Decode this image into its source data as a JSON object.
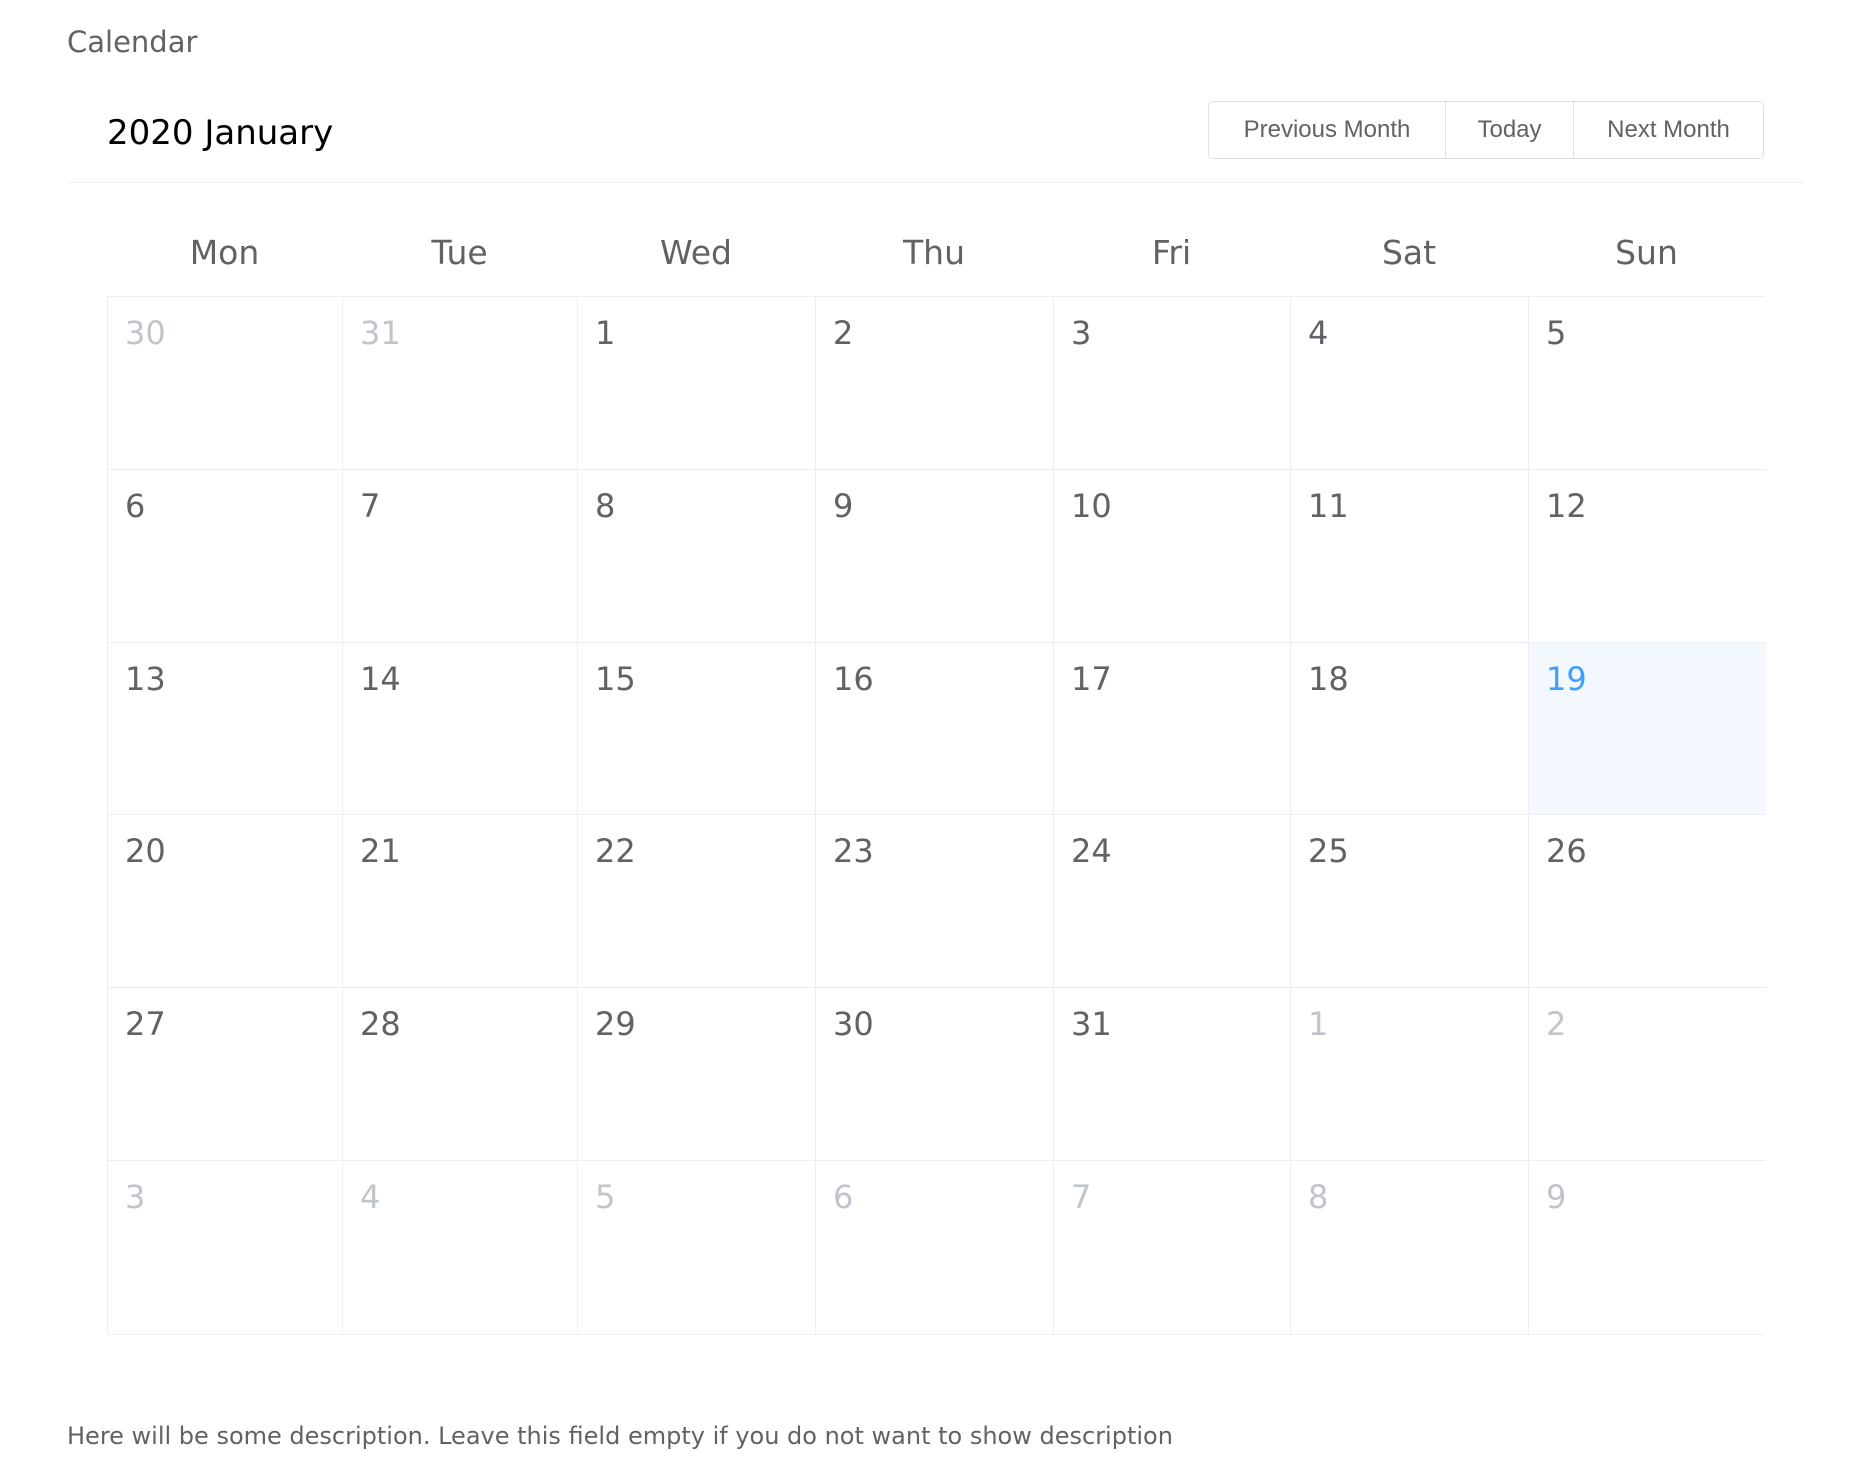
{
  "page_label": "Calendar",
  "header": {
    "title": "2020 January",
    "buttons": {
      "previous": "Previous Month",
      "today": "Today",
      "next": "Next Month"
    }
  },
  "weekdays": [
    "Mon",
    "Tue",
    "Wed",
    "Thu",
    "Fri",
    "Sat",
    "Sun"
  ],
  "colors": {
    "selected_background": "#f2f8fe",
    "selected_text": "#409eff",
    "other_month_text": "#c0c4cc",
    "border": "#ebeef5"
  },
  "weeks": [
    [
      {
        "day": "30",
        "state": "prev"
      },
      {
        "day": "31",
        "state": "prev"
      },
      {
        "day": "1",
        "state": "current"
      },
      {
        "day": "2",
        "state": "current"
      },
      {
        "day": "3",
        "state": "current"
      },
      {
        "day": "4",
        "state": "current"
      },
      {
        "day": "5",
        "state": "current"
      }
    ],
    [
      {
        "day": "6",
        "state": "current"
      },
      {
        "day": "7",
        "state": "current"
      },
      {
        "day": "8",
        "state": "current"
      },
      {
        "day": "9",
        "state": "current"
      },
      {
        "day": "10",
        "state": "current"
      },
      {
        "day": "11",
        "state": "current"
      },
      {
        "day": "12",
        "state": "current"
      }
    ],
    [
      {
        "day": "13",
        "state": "current"
      },
      {
        "day": "14",
        "state": "current"
      },
      {
        "day": "15",
        "state": "current"
      },
      {
        "day": "16",
        "state": "current"
      },
      {
        "day": "17",
        "state": "current"
      },
      {
        "day": "18",
        "state": "current"
      },
      {
        "day": "19",
        "state": "current",
        "selected": true
      }
    ],
    [
      {
        "day": "20",
        "state": "current"
      },
      {
        "day": "21",
        "state": "current"
      },
      {
        "day": "22",
        "state": "current"
      },
      {
        "day": "23",
        "state": "current"
      },
      {
        "day": "24",
        "state": "current"
      },
      {
        "day": "25",
        "state": "current"
      },
      {
        "day": "26",
        "state": "current"
      }
    ],
    [
      {
        "day": "27",
        "state": "current"
      },
      {
        "day": "28",
        "state": "current"
      },
      {
        "day": "29",
        "state": "current"
      },
      {
        "day": "30",
        "state": "current"
      },
      {
        "day": "31",
        "state": "current"
      },
      {
        "day": "1",
        "state": "next"
      },
      {
        "day": "2",
        "state": "next"
      }
    ],
    [
      {
        "day": "3",
        "state": "next"
      },
      {
        "day": "4",
        "state": "next"
      },
      {
        "day": "5",
        "state": "next"
      },
      {
        "day": "6",
        "state": "next"
      },
      {
        "day": "7",
        "state": "next"
      },
      {
        "day": "8",
        "state": "next"
      },
      {
        "day": "9",
        "state": "next"
      }
    ]
  ],
  "description": "Here will be some description. Leave this field empty if you do not want to show description"
}
